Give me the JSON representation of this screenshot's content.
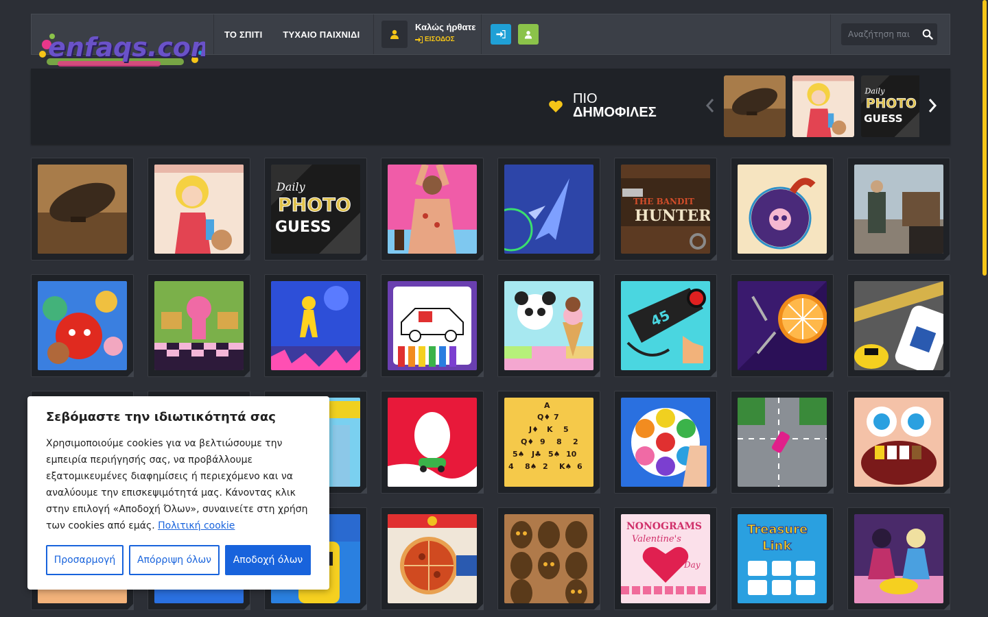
{
  "header": {
    "logo_text": "enfaqs.com",
    "nav": [
      {
        "label": "ΤΟ ΣΠΙΤΙ"
      },
      {
        "label": "ΤΥΧΑΙΟ ΠΑΙΧΝΙΔΙ"
      }
    ],
    "user": {
      "welcome": "Καλώς ήρθατε",
      "login_link": "ΕΙΣΟΔΟΣ"
    },
    "search": {
      "placeholder": "Αναζήτηση παι"
    }
  },
  "popular": {
    "title_line1": "ΠΙΟ",
    "title_line2": "ΔΗΜΟΦΙΛΕΣ",
    "thumbs": [
      "airship",
      "cleaning-girl",
      "daily-photo-guess"
    ]
  },
  "games": [
    {
      "name": "airship"
    },
    {
      "name": "cleaning-girl"
    },
    {
      "name": "daily-photo-guess",
      "text": "Daily PHOTO GUESS"
    },
    {
      "name": "back-doctor"
    },
    {
      "name": "space-jet"
    },
    {
      "name": "bandit-hunter",
      "text": "THE BANDIT HUNTER"
    },
    {
      "name": "skull-bomb"
    },
    {
      "name": "western-shooter"
    },
    {
      "name": "angry-fruits"
    },
    {
      "name": "pink-girl-room"
    },
    {
      "name": "yellow-runner"
    },
    {
      "name": "car-coloring"
    },
    {
      "name": "panda-ice-cream"
    },
    {
      "name": "draw-car-45"
    },
    {
      "name": "orange-knife"
    },
    {
      "name": "police-car"
    },
    {
      "name": "hidden-1"
    },
    {
      "name": "hidden-2"
    },
    {
      "name": "city-runner"
    },
    {
      "name": "egg-cart"
    },
    {
      "name": "solitaire-cards"
    },
    {
      "name": "pop-it"
    },
    {
      "name": "drift-road"
    },
    {
      "name": "crazy-dentist"
    },
    {
      "name": "hidden-3"
    },
    {
      "name": "hidden-4"
    },
    {
      "name": "taxi-rush"
    },
    {
      "name": "pizza-maker"
    },
    {
      "name": "tribal-masks"
    },
    {
      "name": "nonograms-valentines",
      "text": "NONOGRAMS Valentine's Day"
    },
    {
      "name": "treasure-link",
      "text": "Treasure Link"
    },
    {
      "name": "kitchen-girls"
    }
  ],
  "cookie": {
    "title": "Σεβόμαστε την ιδιωτικότητά σας",
    "body": "Χρησιμοποιούμε cookies για να βελτιώσουμε την εμπειρία περιήγησής σας, να προβάλλουμε εξατομικευμένες διαφημίσεις ή περιεχόμενο και να αναλύουμε την επισκεψιμότητά μας. Κάνοντας κλικ στην επιλογή «Αποδοχή Όλων», συναινείτε στη χρήση των cookies από εμάς.",
    "policy_link": "Πολιτική cookie",
    "customize": "Προσαρμογή",
    "reject": "Απόρριψη όλων",
    "accept": "Αποδοχή όλων"
  },
  "colors": {
    "accent": "#f5c518",
    "login_btn": "#1fa0d6",
    "register_btn": "#8bc34a",
    "cookie_blue": "#1863dc"
  }
}
